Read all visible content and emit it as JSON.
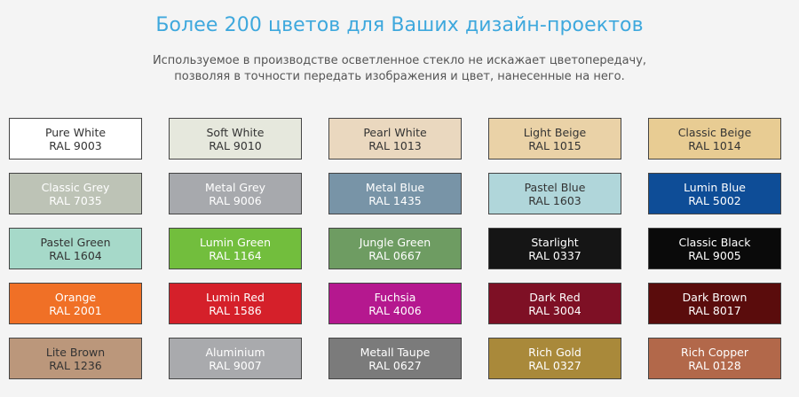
{
  "header": {
    "title": "Более 200 цветов для Ваших дизайн-проектов",
    "subtitle_line1": "Используемое в производстве осветленное стекло не искажает цветопередачу,",
    "subtitle_line2": "позволяя в точности передать изображения и цвет, нанесенные на него."
  },
  "swatches": [
    {
      "name": "Pure White",
      "code": "RAL 9003",
      "color": "#ffffff",
      "text_color": "#333333"
    },
    {
      "name": "Soft White",
      "code": "RAL 9010",
      "color": "#e6e8dd",
      "text_color": "#333333"
    },
    {
      "name": "Pearl White",
      "code": "RAL 1013",
      "color": "#ead8bf",
      "text_color": "#333333"
    },
    {
      "name": "Light Beige",
      "code": "RAL 1015",
      "color": "#ead2a7",
      "text_color": "#333333"
    },
    {
      "name": "Classic Beige",
      "code": "RAL 1014",
      "color": "#e8cc93",
      "text_color": "#333333"
    },
    {
      "name": "Classic Grey",
      "code": "RAL 7035",
      "color": "#bdc3b6",
      "text_color": "#ffffff"
    },
    {
      "name": "Metal Grey",
      "code": "RAL 9006",
      "color": "#a7a9ad",
      "text_color": "#ffffff"
    },
    {
      "name": "Metal Blue",
      "code": "RAL 1435",
      "color": "#7894a7",
      "text_color": "#ffffff"
    },
    {
      "name": "Pastel Blue",
      "code": "RAL 1603",
      "color": "#b0d6da",
      "text_color": "#333333"
    },
    {
      "name": "Lumin Blue",
      "code": "RAL 5002",
      "color": "#0e4d97",
      "text_color": "#ffffff"
    },
    {
      "name": "Pastel Green",
      "code": "RAL 1604",
      "color": "#a6d9c9",
      "text_color": "#333333"
    },
    {
      "name": "Lumin Green",
      "code": "RAL 1164",
      "color": "#72be3d",
      "text_color": "#ffffff"
    },
    {
      "name": "Jungle Green",
      "code": "RAL 0667",
      "color": "#6e9c62",
      "text_color": "#ffffff"
    },
    {
      "name": "Starlight",
      "code": "RAL 0337",
      "color": "#151515",
      "text_color": "#ffffff"
    },
    {
      "name": "Classic Black",
      "code": "RAL 9005",
      "color": "#0a0a0a",
      "text_color": "#ffffff"
    },
    {
      "name": "Orange",
      "code": "RAL 2001",
      "color": "#f07026",
      "text_color": "#ffffff"
    },
    {
      "name": "Lumin Red",
      "code": "RAL 1586",
      "color": "#d5202a",
      "text_color": "#ffffff"
    },
    {
      "name": "Fuchsia",
      "code": "RAL 4006",
      "color": "#b5188f",
      "text_color": "#ffffff"
    },
    {
      "name": "Dark Red",
      "code": "RAL 3004",
      "color": "#7e1025",
      "text_color": "#ffffff"
    },
    {
      "name": "Dark Brown",
      "code": "RAL 8017",
      "color": "#5a0c0c",
      "text_color": "#ffffff"
    },
    {
      "name": "Lite Brown",
      "code": "RAL 1236",
      "color": "#bb977b",
      "text_color": "#333333"
    },
    {
      "name": "Aluminium",
      "code": "RAL 9007",
      "color": "#a9aaad",
      "text_color": "#ffffff"
    },
    {
      "name": "Metall Taupe",
      "code": "RAL 0627",
      "color": "#7b7b7b",
      "text_color": "#ffffff"
    },
    {
      "name": "Rich Gold",
      "code": "RAL 0327",
      "color": "#a9893a",
      "text_color": "#ffffff"
    },
    {
      "name": "Rich Copper",
      "code": "RAL 0128",
      "color": "#b2684a",
      "text_color": "#ffffff"
    }
  ]
}
